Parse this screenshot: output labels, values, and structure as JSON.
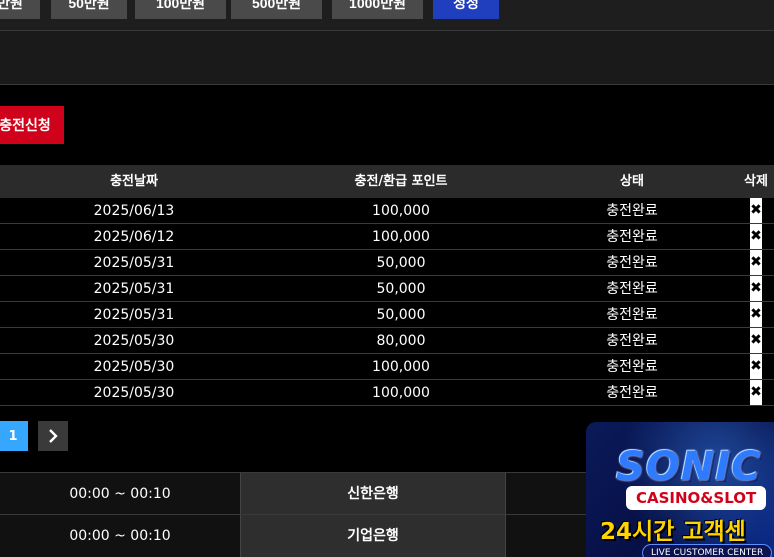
{
  "amount_buttons": [
    {
      "label": "만원"
    },
    {
      "label": "50만원"
    },
    {
      "label": "100만원"
    },
    {
      "label": "500만원"
    },
    {
      "label": "1000만원"
    },
    {
      "label": "정정"
    }
  ],
  "apply_button": {
    "label": "충전신청"
  },
  "history_table": {
    "headers": {
      "date": "충전날짜",
      "points": "충전/환급 포인트",
      "status": "상태",
      "delete": "삭제"
    },
    "rows": [
      {
        "date": "2025/06/13",
        "points": "100,000",
        "status": "충전완료",
        "delete": "✖"
      },
      {
        "date": "2025/06/12",
        "points": "100,000",
        "status": "충전완료",
        "delete": "✖"
      },
      {
        "date": "2025/05/31",
        "points": "50,000",
        "status": "충전완료",
        "delete": "✖"
      },
      {
        "date": "2025/05/31",
        "points": "50,000",
        "status": "충전완료",
        "delete": "✖"
      },
      {
        "date": "2025/05/31",
        "points": "50,000",
        "status": "충전완료",
        "delete": "✖"
      },
      {
        "date": "2025/05/30",
        "points": "80,000",
        "status": "충전완료",
        "delete": "✖"
      },
      {
        "date": "2025/05/30",
        "points": "100,000",
        "status": "충전완료",
        "delete": "✖"
      },
      {
        "date": "2025/05/30",
        "points": "100,000",
        "status": "충전완료",
        "delete": "✖"
      }
    ]
  },
  "pagination": {
    "current_page": "1",
    "next_icon": "chevron-right-icon"
  },
  "bank_table": {
    "rows": [
      {
        "time": "00:00 ~ 00:10",
        "bank": "신한은행"
      },
      {
        "time": "00:00 ~ 00:10",
        "bank": "기업은행"
      }
    ]
  },
  "banner": {
    "brand": "SONIC",
    "tagline": "CASINO&SLOT",
    "headline": "24시간 고객센",
    "subline": "LIVE CUSTOMER CENTER"
  },
  "colors": {
    "accent_blue": "#1f3fbf",
    "apply_red": "#d0021b",
    "page_active": "#35a7ff"
  }
}
